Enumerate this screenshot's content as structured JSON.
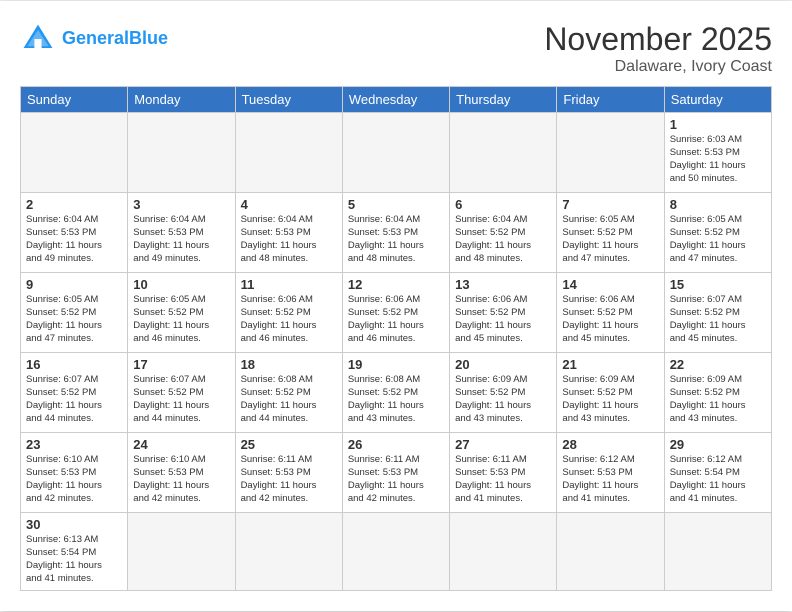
{
  "header": {
    "logo_general": "General",
    "logo_blue": "Blue",
    "month": "November 2025",
    "location": "Dalaware, Ivory Coast"
  },
  "days_of_week": [
    "Sunday",
    "Monday",
    "Tuesday",
    "Wednesday",
    "Thursday",
    "Friday",
    "Saturday"
  ],
  "weeks": [
    [
      {
        "day": "",
        "info": ""
      },
      {
        "day": "",
        "info": ""
      },
      {
        "day": "",
        "info": ""
      },
      {
        "day": "",
        "info": ""
      },
      {
        "day": "",
        "info": ""
      },
      {
        "day": "",
        "info": ""
      },
      {
        "day": "1",
        "info": "Sunrise: 6:03 AM\nSunset: 5:53 PM\nDaylight: 11 hours\nand 50 minutes."
      }
    ],
    [
      {
        "day": "2",
        "info": "Sunrise: 6:04 AM\nSunset: 5:53 PM\nDaylight: 11 hours\nand 49 minutes."
      },
      {
        "day": "3",
        "info": "Sunrise: 6:04 AM\nSunset: 5:53 PM\nDaylight: 11 hours\nand 49 minutes."
      },
      {
        "day": "4",
        "info": "Sunrise: 6:04 AM\nSunset: 5:53 PM\nDaylight: 11 hours\nand 48 minutes."
      },
      {
        "day": "5",
        "info": "Sunrise: 6:04 AM\nSunset: 5:53 PM\nDaylight: 11 hours\nand 48 minutes."
      },
      {
        "day": "6",
        "info": "Sunrise: 6:04 AM\nSunset: 5:52 PM\nDaylight: 11 hours\nand 48 minutes."
      },
      {
        "day": "7",
        "info": "Sunrise: 6:05 AM\nSunset: 5:52 PM\nDaylight: 11 hours\nand 47 minutes."
      },
      {
        "day": "8",
        "info": "Sunrise: 6:05 AM\nSunset: 5:52 PM\nDaylight: 11 hours\nand 47 minutes."
      }
    ],
    [
      {
        "day": "9",
        "info": "Sunrise: 6:05 AM\nSunset: 5:52 PM\nDaylight: 11 hours\nand 47 minutes."
      },
      {
        "day": "10",
        "info": "Sunrise: 6:05 AM\nSunset: 5:52 PM\nDaylight: 11 hours\nand 46 minutes."
      },
      {
        "day": "11",
        "info": "Sunrise: 6:06 AM\nSunset: 5:52 PM\nDaylight: 11 hours\nand 46 minutes."
      },
      {
        "day": "12",
        "info": "Sunrise: 6:06 AM\nSunset: 5:52 PM\nDaylight: 11 hours\nand 46 minutes."
      },
      {
        "day": "13",
        "info": "Sunrise: 6:06 AM\nSunset: 5:52 PM\nDaylight: 11 hours\nand 45 minutes."
      },
      {
        "day": "14",
        "info": "Sunrise: 6:06 AM\nSunset: 5:52 PM\nDaylight: 11 hours\nand 45 minutes."
      },
      {
        "day": "15",
        "info": "Sunrise: 6:07 AM\nSunset: 5:52 PM\nDaylight: 11 hours\nand 45 minutes."
      }
    ],
    [
      {
        "day": "16",
        "info": "Sunrise: 6:07 AM\nSunset: 5:52 PM\nDaylight: 11 hours\nand 44 minutes."
      },
      {
        "day": "17",
        "info": "Sunrise: 6:07 AM\nSunset: 5:52 PM\nDaylight: 11 hours\nand 44 minutes."
      },
      {
        "day": "18",
        "info": "Sunrise: 6:08 AM\nSunset: 5:52 PM\nDaylight: 11 hours\nand 44 minutes."
      },
      {
        "day": "19",
        "info": "Sunrise: 6:08 AM\nSunset: 5:52 PM\nDaylight: 11 hours\nand 43 minutes."
      },
      {
        "day": "20",
        "info": "Sunrise: 6:09 AM\nSunset: 5:52 PM\nDaylight: 11 hours\nand 43 minutes."
      },
      {
        "day": "21",
        "info": "Sunrise: 6:09 AM\nSunset: 5:52 PM\nDaylight: 11 hours\nand 43 minutes."
      },
      {
        "day": "22",
        "info": "Sunrise: 6:09 AM\nSunset: 5:52 PM\nDaylight: 11 hours\nand 43 minutes."
      }
    ],
    [
      {
        "day": "23",
        "info": "Sunrise: 6:10 AM\nSunset: 5:53 PM\nDaylight: 11 hours\nand 42 minutes."
      },
      {
        "day": "24",
        "info": "Sunrise: 6:10 AM\nSunset: 5:53 PM\nDaylight: 11 hours\nand 42 minutes."
      },
      {
        "day": "25",
        "info": "Sunrise: 6:11 AM\nSunset: 5:53 PM\nDaylight: 11 hours\nand 42 minutes."
      },
      {
        "day": "26",
        "info": "Sunrise: 6:11 AM\nSunset: 5:53 PM\nDaylight: 11 hours\nand 42 minutes."
      },
      {
        "day": "27",
        "info": "Sunrise: 6:11 AM\nSunset: 5:53 PM\nDaylight: 11 hours\nand 41 minutes."
      },
      {
        "day": "28",
        "info": "Sunrise: 6:12 AM\nSunset: 5:53 PM\nDaylight: 11 hours\nand 41 minutes."
      },
      {
        "day": "29",
        "info": "Sunrise: 6:12 AM\nSunset: 5:54 PM\nDaylight: 11 hours\nand 41 minutes."
      }
    ],
    [
      {
        "day": "30",
        "info": "Sunrise: 6:13 AM\nSunset: 5:54 PM\nDaylight: 11 hours\nand 41 minutes."
      },
      {
        "day": "",
        "info": ""
      },
      {
        "day": "",
        "info": ""
      },
      {
        "day": "",
        "info": ""
      },
      {
        "day": "",
        "info": ""
      },
      {
        "day": "",
        "info": ""
      },
      {
        "day": "",
        "info": ""
      }
    ]
  ]
}
